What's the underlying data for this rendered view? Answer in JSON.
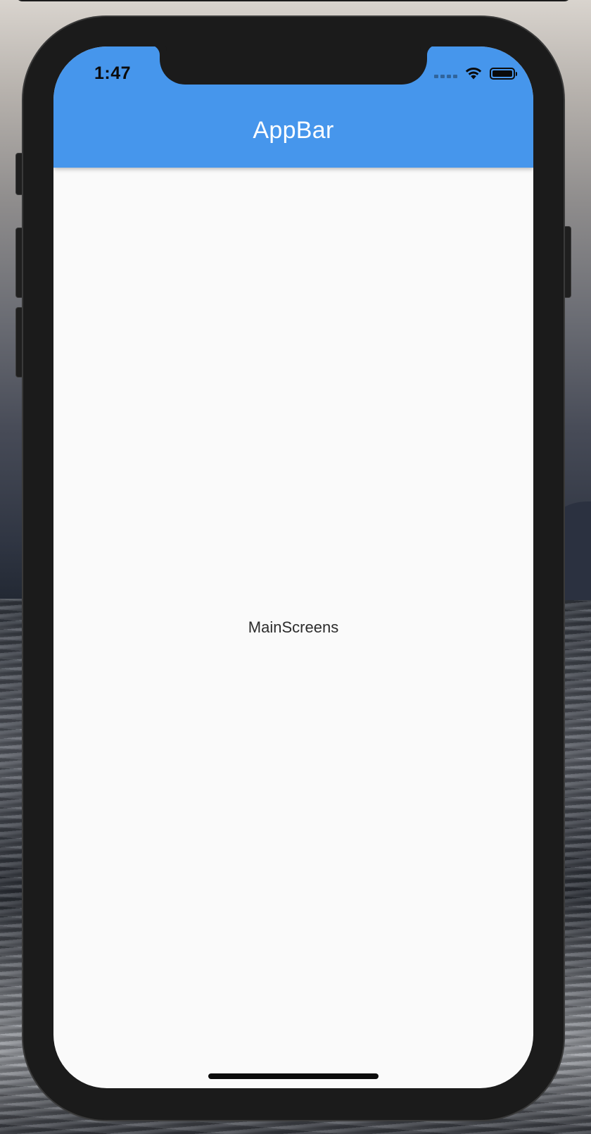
{
  "status_bar": {
    "time": "1:47",
    "icons": [
      "cellular-signal-icon",
      "wifi-icon",
      "battery-icon"
    ]
  },
  "app_bar": {
    "title": "AppBar",
    "color": "#4696ec"
  },
  "body": {
    "text": "MainScreens",
    "background": "#fafafa"
  }
}
